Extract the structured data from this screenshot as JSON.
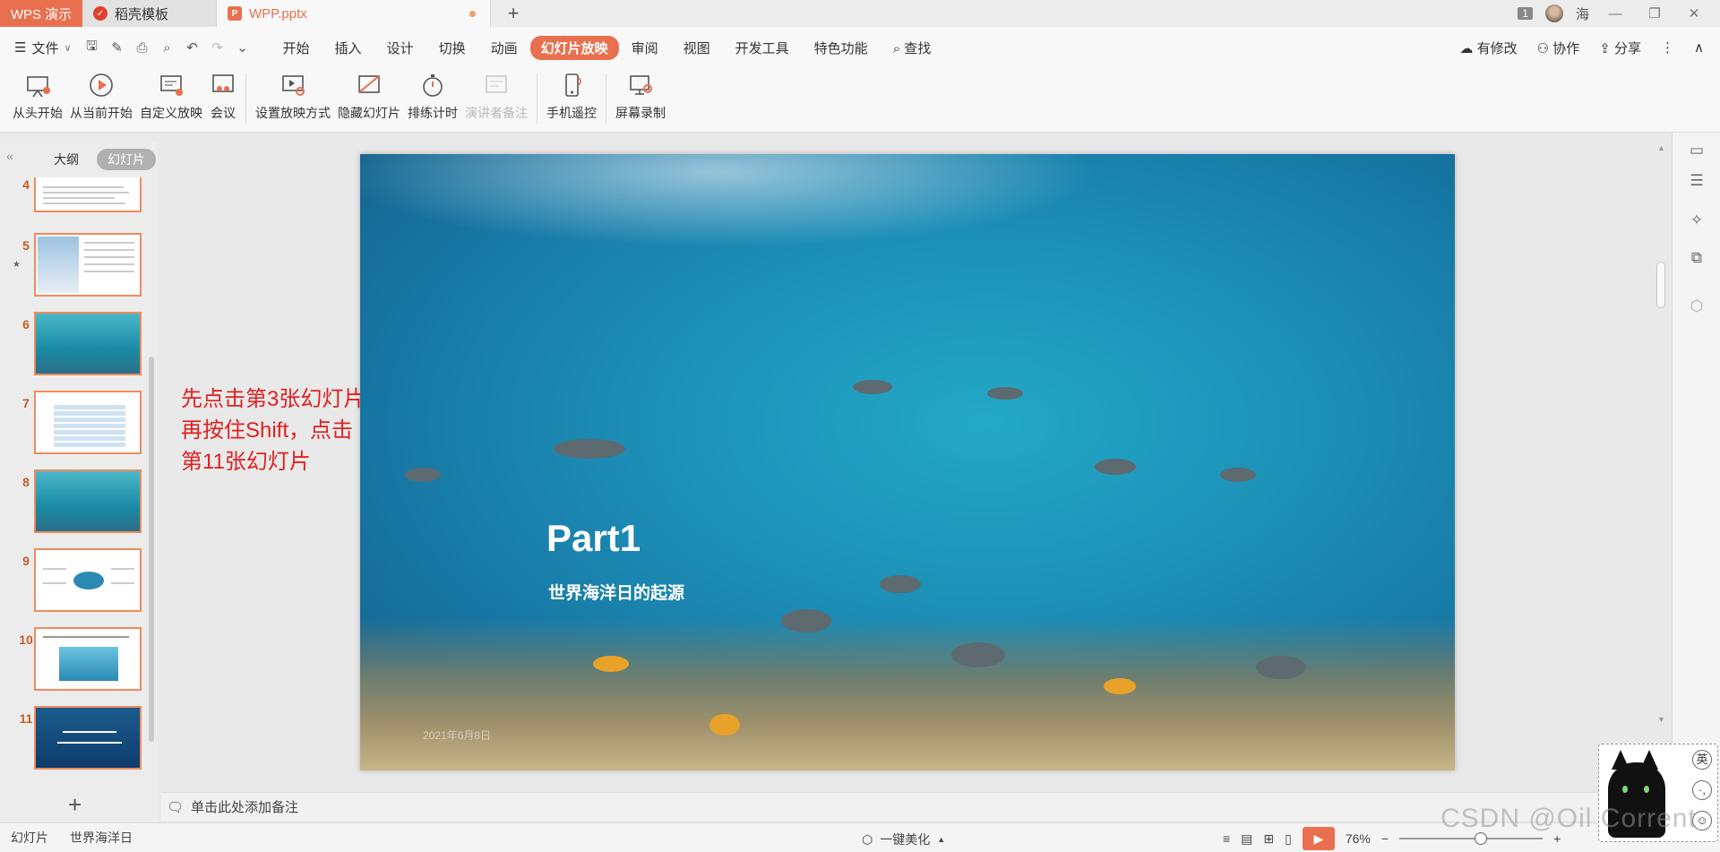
{
  "titlebar": {
    "app_tab": "WPS 演示",
    "tabs": [
      {
        "label": "稻壳模板"
      },
      {
        "label": "WPP.pptx"
      }
    ],
    "new_tab": "+",
    "window_badge": "1",
    "user_name": "海"
  },
  "menubar": {
    "file_label": "文件",
    "items": [
      "开始",
      "插入",
      "设计",
      "切换",
      "动画",
      "幻灯片放映",
      "审阅",
      "视图",
      "开发工具",
      "特色功能"
    ],
    "search_label": "查找",
    "right": {
      "modified": "有修改",
      "collab": "协作",
      "share": "分享"
    }
  },
  "ribbon": {
    "buttons": [
      "从头开始",
      "从当前开始",
      "自定义放映",
      "会议",
      "设置放映方式",
      "隐藏幻灯片",
      "排练计时",
      "演讲者备注",
      "手机遥控",
      "屏幕录制"
    ]
  },
  "leftpanel": {
    "tabs": [
      "大纲",
      "幻灯片"
    ],
    "thumbnails": [
      {
        "number": "4"
      },
      {
        "number": "5"
      },
      {
        "number": "6"
      },
      {
        "number": "7"
      },
      {
        "number": "8"
      },
      {
        "number": "9"
      },
      {
        "number": "10"
      },
      {
        "number": "11"
      }
    ]
  },
  "annotation": {
    "lines": [
      "先点击第3张幻灯片",
      "再按住Shift，点击",
      "第11张幻灯片"
    ]
  },
  "slide": {
    "title": "Part1",
    "subtitle": "世界海洋日的起源",
    "date": "2021年6月8日"
  },
  "notes": {
    "placeholder": "单击此处添加备注"
  },
  "status": {
    "slide_label": "幻灯片",
    "theme_name": "世界海洋日",
    "beautify": "一键美化",
    "zoom": "76%"
  },
  "ime": {
    "keys": [
      "英",
      "·,",
      "☺"
    ]
  },
  "watermark": "CSDN @Oil Corrent"
}
